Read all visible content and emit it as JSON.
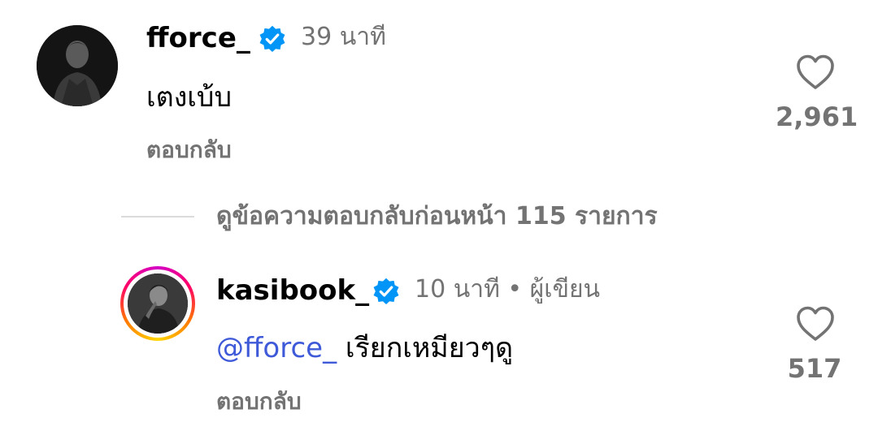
{
  "comments": [
    {
      "username": "fforce_",
      "verified": true,
      "time": "39 นาที",
      "text": "เตงเบ้บ",
      "reply_label": "ตอบกลับ",
      "likes": "2,961",
      "avatar_icon": "profile-photo"
    }
  ],
  "view_replies_label": "ดูข้อความตอบกลับก่อนหน้า 115 รายการ",
  "reply": {
    "username": "kasibook_",
    "verified": true,
    "time": "10 นาที",
    "separator": "•",
    "author_label": "ผู้เขียน",
    "mention": "@fforce_",
    "text": " เรียกเหมียวๆดู",
    "reply_label": "ตอบกลับ",
    "likes": "517",
    "avatar_icon": "profile-photo-story-ring"
  },
  "colors": {
    "verified_blue": "#0095f6",
    "secondary_text": "#737373",
    "mention_blue": "#3f5ad8",
    "divider": "#dbdbdb"
  },
  "icons": {
    "verified": "verified-badge-icon",
    "like": "heart-outline-icon"
  }
}
